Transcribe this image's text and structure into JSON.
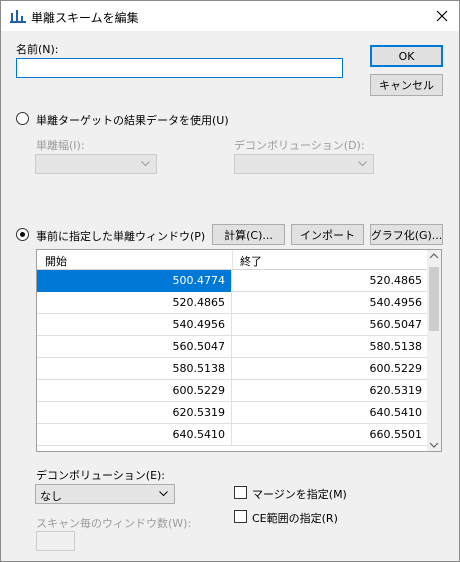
{
  "window": {
    "title": "単離スキームを編集"
  },
  "name_field": {
    "label": "名前(N):",
    "value": ""
  },
  "buttons": {
    "ok": "OK",
    "cancel": "キャンセル",
    "calculate": "計算(C)...",
    "import": "インポート",
    "graph": "グラフ化(G)..."
  },
  "option_target": {
    "label": "単離ターゲットの結果データを使用(U)",
    "selected": false,
    "width_label": "単離幅(I):",
    "width_value": "",
    "deconv_label": "デコンボリューション(D):",
    "deconv_value": ""
  },
  "option_window": {
    "label": "事前に指定した単離ウィンドウ(P)",
    "selected": true
  },
  "table": {
    "columns": [
      "開始",
      "終了"
    ],
    "rows": [
      [
        "500.4774",
        "520.4865"
      ],
      [
        "520.4865",
        "540.4956"
      ],
      [
        "540.4956",
        "560.5047"
      ],
      [
        "560.5047",
        "580.5138"
      ],
      [
        "580.5138",
        "600.5229"
      ],
      [
        "600.5229",
        "620.5319"
      ],
      [
        "620.5319",
        "640.5410"
      ],
      [
        "640.5410",
        "660.5501"
      ]
    ],
    "selected_row": 0
  },
  "deconvolution": {
    "label": "デコンボリューション(E):",
    "value": "なし"
  },
  "windows_per_cycle": {
    "label": "スキャン毎のウィンドウ数(W):",
    "value": ""
  },
  "checkboxes": {
    "margin": {
      "label": "マージンを指定(M)",
      "checked": false
    },
    "ce_range": {
      "label": "CE範囲の指定(R)",
      "checked": false
    }
  }
}
